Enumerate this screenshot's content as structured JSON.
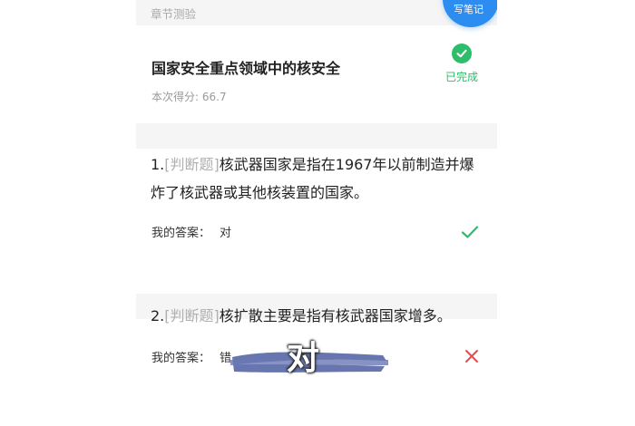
{
  "header": {
    "section_title": "章节测验"
  },
  "fab": {
    "label": "写笔记"
  },
  "quiz": {
    "title": "国家安全重点领域中的核安全",
    "score": "本次得分: 66.7",
    "status": "已完成"
  },
  "questions": [
    {
      "number": "1.",
      "type": "[判断题]",
      "text": "核武器国家是指在1967年以前制造并爆炸了核武器或其他核装置的国家。",
      "answer_label": "我的答案：",
      "answer_value": "对",
      "result": "correct"
    },
    {
      "number": "2.",
      "type": "[判断题]",
      "text": "核扩散主要是指有核武器国家增多。",
      "answer_label": "我的答案：",
      "answer_value": "错",
      "result": "wrong"
    }
  ],
  "overlay": {
    "text": "对"
  },
  "colors": {
    "accent_green": "#2ebd6b",
    "accent_blue": "#2d8cf0",
    "wrong_red": "#e34d4d",
    "highlight_stroke": "#5a6aa8"
  }
}
